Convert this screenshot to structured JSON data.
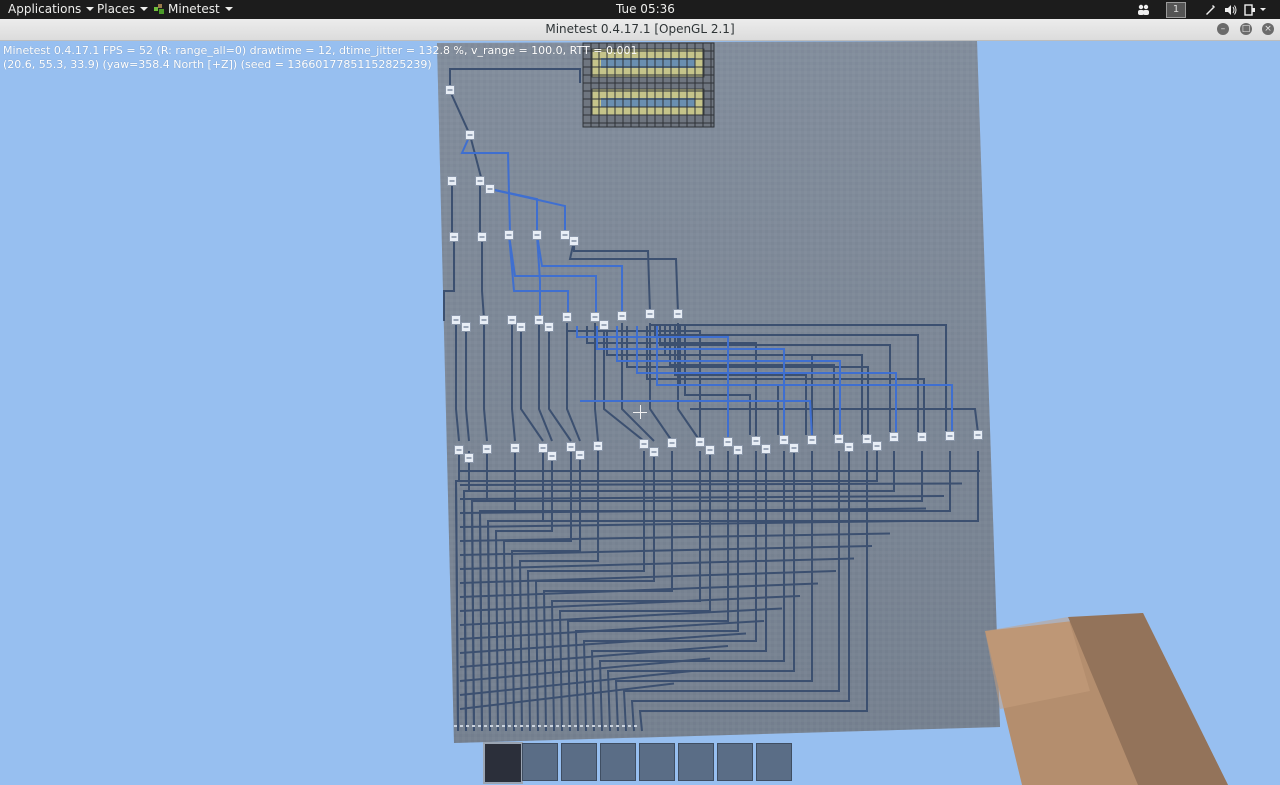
{
  "topbar": {
    "applications": "Applications",
    "places": "Places",
    "app_menu": "Minetest",
    "clock": "Tue 05:36",
    "workspace": "1",
    "tray_icons": [
      "people-icon",
      "workspace-indicator",
      "pen-icon",
      "volume-icon",
      "power-icon"
    ]
  },
  "window": {
    "title": "Minetest 0.4.17.1 [OpenGL 2.1]",
    "buttons": [
      "minimize-icon",
      "maximize-icon",
      "close-icon"
    ]
  },
  "hud": {
    "debug_line1": "Minetest 0.4.17.1 FPS = 52 (R: range_all=0) drawtime = 12, dtime_jitter = 132.8 %, v_range = 100.0, RTT = 0.001",
    "debug_line2": "(20.6, 55.3, 33.9) (yaw=358.4 North [+Z]) (seed = 13660177851152825239)",
    "hotbar_slots": 8,
    "selected_slot": 1
  },
  "colors": {
    "sky": "#97bff0",
    "stone": "#7f8a99",
    "wire_dark": "#3c5070",
    "wire_blue": "#3f6fd0",
    "node": "#e8eef6",
    "hand": "#b7906f",
    "panel": "#1c1c1c"
  }
}
